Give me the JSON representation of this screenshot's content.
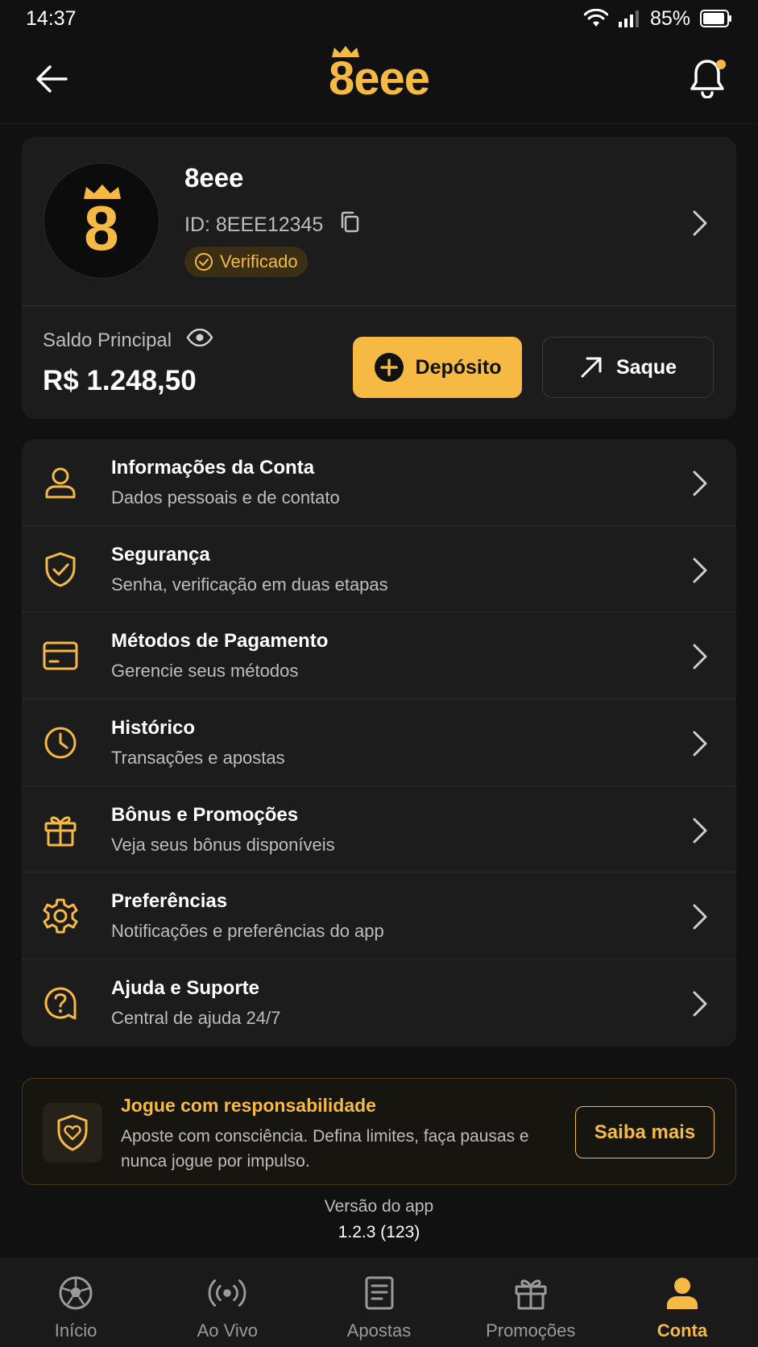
{
  "status_bar": {
    "time": "14:37",
    "battery": "85%"
  },
  "header": {
    "logo_text": "8eee"
  },
  "profile": {
    "avatar_text": "8",
    "name": "8eee",
    "id_label": "ID: 8EEE12345",
    "verified_label": "Verificado"
  },
  "balance": {
    "label": "Saldo Principal",
    "value": "R$ 1.248,50",
    "deposit_label": "Depósito",
    "withdraw_label": "Saque"
  },
  "menu": [
    {
      "icon": "user-icon",
      "title": "Informações da Conta",
      "subtitle": "Dados pessoais e de contato"
    },
    {
      "icon": "shield-check-icon",
      "title": "Segurança",
      "subtitle": "Senha, verificação em duas etapas"
    },
    {
      "icon": "credit-card-icon",
      "title": "Métodos de Pagamento",
      "subtitle": "Gerencie seus métodos"
    },
    {
      "icon": "clock-icon",
      "title": "Histórico",
      "subtitle": "Transações e apostas"
    },
    {
      "icon": "gift-icon",
      "title": "Bônus e Promoções",
      "subtitle": "Veja seus bônus disponíveis"
    },
    {
      "icon": "gear-icon",
      "title": "Preferências",
      "subtitle": "Notificações e preferências do app"
    },
    {
      "icon": "help-icon",
      "title": "Ajuda e Suporte",
      "subtitle": "Central de ajuda 24/7"
    }
  ],
  "responsible": {
    "title": "Jogue com responsabilidade",
    "text": "Aposte com consciência. Defina limites, faça pausas e nunca jogue por impulso.",
    "button": "Saiba mais"
  },
  "version": {
    "label": "Versão do app",
    "value": "1.2.3 (123)"
  },
  "bottom_nav": [
    {
      "icon": "soccer-ball-icon",
      "label": "Início",
      "active": false
    },
    {
      "icon": "live-broadcast-icon",
      "label": "Ao Vivo",
      "active": false
    },
    {
      "icon": "document-icon",
      "label": "Apostas",
      "active": false
    },
    {
      "icon": "gift-icon",
      "label": "Promoções",
      "active": false
    },
    {
      "icon": "person-icon",
      "label": "Conta",
      "active": true
    }
  ],
  "colors": {
    "accent": "#F5B944",
    "background": "#111111",
    "card": "#1c1c1c"
  }
}
